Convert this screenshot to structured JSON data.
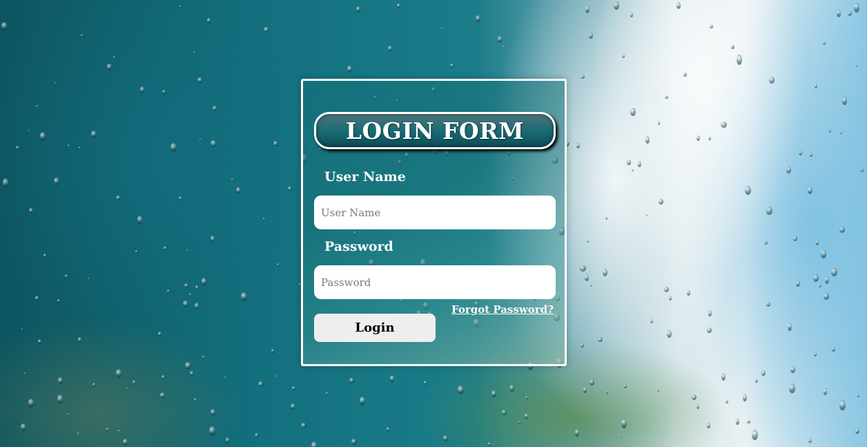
{
  "form": {
    "title": "LOGIN FORM",
    "username_label": "User Name",
    "username_placeholder": "User Name",
    "password_label": "Password",
    "password_placeholder": "Password",
    "forgot_link": "Forgot Password?",
    "login_label": "Login"
  },
  "colors": {
    "card_border": "#ffffff",
    "title_pill": "#176a74",
    "button_bg": "#eeeeee"
  }
}
